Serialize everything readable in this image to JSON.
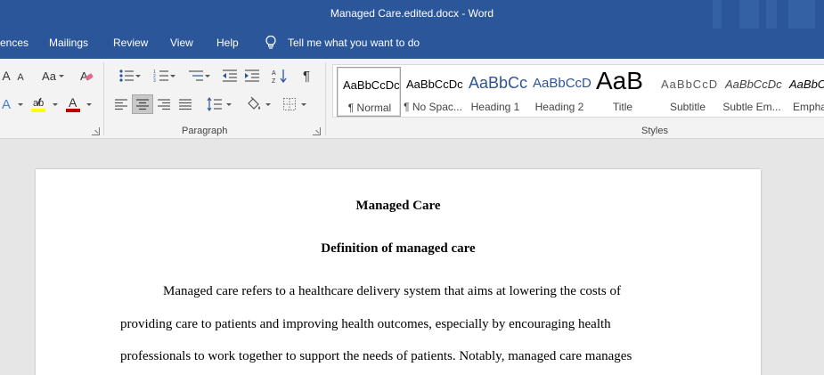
{
  "window": {
    "title": "Managed Care.edited.docx  -  Word"
  },
  "menu": {
    "tabs": [
      "ences",
      "Mailings",
      "Review",
      "View",
      "Help"
    ],
    "tell_me": "Tell me what you want to do"
  },
  "ribbon": {
    "font_group": {
      "grow_label": "A",
      "shrink_label": "A",
      "case_label": "Aa",
      "text_effects_label": "A",
      "font_color_label": "A"
    },
    "paragraph_group": {
      "label": "Paragraph",
      "pilcrow": "¶"
    },
    "styles_group": {
      "label": "Styles",
      "items": [
        {
          "sample": "AaBbCcDc",
          "name": "¶ Normal"
        },
        {
          "sample": "AaBbCcDc",
          "name": "¶ No Spac..."
        },
        {
          "sample": "AaBbCc",
          "name": "Heading 1"
        },
        {
          "sample": "AaBbCcD",
          "name": "Heading 2"
        },
        {
          "sample": "AaB",
          "name": "Title"
        },
        {
          "sample": "AaBbCcD",
          "name": "Subtitle"
        },
        {
          "sample": "AaBbCcDc",
          "name": "Subtle Em..."
        },
        {
          "sample": "AaBbCcI",
          "name": "Empha"
        }
      ]
    }
  },
  "colors": {
    "brand": "#2b579a",
    "highlight": "#ffff00",
    "font_color": "#c00000",
    "heading_blue": "#2f5496"
  },
  "document": {
    "title": "Managed Care",
    "heading": "Definition of managed care",
    "lines": [
      "Managed care refers to a healthcare delivery system that aims at lowering the costs of",
      "providing care to patients and improving health outcomes, especially by encouraging health",
      "professionals to work together to support the needs of patients. Notably, managed care manages"
    ]
  }
}
